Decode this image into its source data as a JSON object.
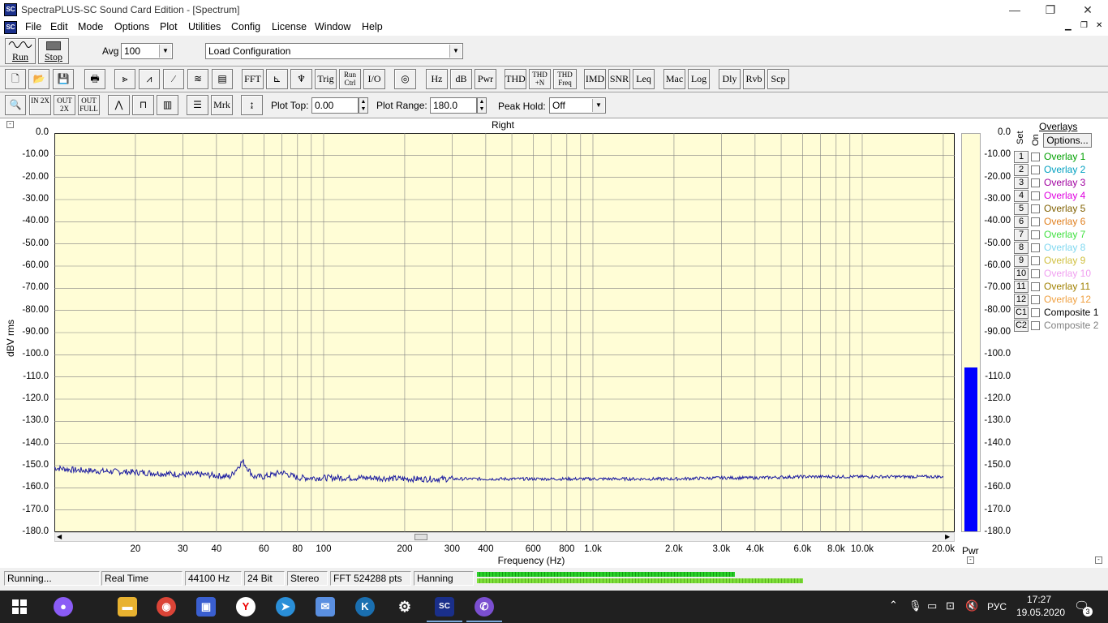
{
  "window": {
    "title": "SpectraPLUS-SC Sound Card Edition - [Spectrum]",
    "minimize": "—",
    "restore": "❐",
    "close": "✕",
    "app_icon": "SC"
  },
  "menu": [
    "File",
    "Edit",
    "Mode",
    "Options",
    "Plot",
    "Utilities",
    "Config",
    "License",
    "Window",
    "Help"
  ],
  "toolbar1": {
    "run_label": "Run",
    "stop_label": "Stop",
    "avg_label": "Avg",
    "avg_value": "100",
    "config_value": "Load Configuration"
  },
  "toolbar2": {
    "buttons": [
      "FFT",
      "Trig",
      "Run Ctrl",
      "I/O",
      "Hz",
      "dB",
      "Pwr",
      "THD",
      "THD +N",
      "THD Freq",
      "IMD",
      "SNR",
      "Leq",
      "Mac",
      "Log",
      "Dly",
      "Rvb",
      "Scp"
    ]
  },
  "toolbar3": {
    "mrk_label": "Mrk",
    "zoom_in_label": "IN 2X",
    "zoom_out_label": "OUT 2X",
    "zoom_full_label": "OUT FULL",
    "plot_top_label": "Plot Top:",
    "plot_top_value": "0.00",
    "plot_range_label": "Plot Range:",
    "plot_range_value": "180.0",
    "peak_hold_label": "Peak Hold:",
    "peak_hold_value": "Off"
  },
  "plot": {
    "channel_title": "Right",
    "y_axis_label": "dBV rms",
    "x_axis_label": "Frequency (Hz)",
    "y_ticks": [
      "0.0",
      "-10.00",
      "-20.00",
      "-30.00",
      "-40.00",
      "-50.00",
      "-60.00",
      "-70.00",
      "-80.00",
      "-90.00",
      "-100.0",
      "-110.0",
      "-120.0",
      "-130.0",
      "-140.0",
      "-150.0",
      "-160.0",
      "-170.0",
      "-180.0"
    ],
    "x_ticks": [
      "20",
      "30",
      "40",
      "60",
      "80",
      "100",
      "200",
      "300",
      "400",
      "600",
      "800",
      "1.0k",
      "2.0k",
      "3.0k",
      "4.0k",
      "6.0k",
      "8.0k",
      "10.0k",
      "20.0k"
    ],
    "pwr_ticks": [
      "0.0",
      "-10.00",
      "-20.00",
      "-30.00",
      "-40.00",
      "-50.00",
      "-60.00",
      "-70.00",
      "-80.00",
      "-90.00",
      "-100.0",
      "-110.0",
      "-120.0",
      "-130.0",
      "-140.0",
      "-150.0",
      "-160.0",
      "-170.0",
      "-180.0"
    ],
    "pwr_label": "Pwr",
    "pwr_level_db": -106,
    "colors": {
      "background": "#fffdd6",
      "trace": "#1a1aa0",
      "pwr_bar": "#0000ff"
    }
  },
  "chart_data": {
    "type": "line",
    "title": "Right",
    "xlabel": "Frequency (Hz)",
    "ylabel": "dBV rms",
    "xscale": "log",
    "xlim": [
      10,
      22050
    ],
    "ylim": [
      -180,
      0
    ],
    "grid": true,
    "series": [
      {
        "values_x": [
          10,
          12,
          15,
          20,
          25,
          30,
          35,
          40,
          45,
          50,
          55,
          60,
          70,
          80,
          100,
          150,
          200,
          300,
          400,
          600,
          800,
          1000,
          2000,
          3000,
          4000,
          6000,
          8000,
          10000,
          15000,
          20000
        ],
        "values_y": [
          -151,
          -152,
          -152.5,
          -153,
          -153.5,
          -154,
          -154,
          -154.5,
          -155,
          -148,
          -155,
          -155,
          -153,
          -155.5,
          -155.5,
          -155.5,
          -156,
          -156,
          -156,
          -156,
          -156,
          -156,
          -156,
          -155.5,
          -155.5,
          -155,
          -155,
          -155,
          -155,
          -155
        ]
      }
    ]
  },
  "overlays": {
    "title": "Overlays",
    "set_label": "Set",
    "on_label": "On",
    "options_label": "Options...",
    "items": [
      {
        "num": "1",
        "name": "Overlay 1",
        "color": "#00a000"
      },
      {
        "num": "2",
        "name": "Overlay 2",
        "color": "#00a0c0"
      },
      {
        "num": "3",
        "name": "Overlay 3",
        "color": "#a000a0"
      },
      {
        "num": "4",
        "name": "Overlay 4",
        "color": "#e000e0"
      },
      {
        "num": "5",
        "name": "Overlay 5",
        "color": "#806000"
      },
      {
        "num": "6",
        "name": "Overlay 6",
        "color": "#e08020"
      },
      {
        "num": "7",
        "name": "Overlay 7",
        "color": "#40e040"
      },
      {
        "num": "8",
        "name": "Overlay 8",
        "color": "#80d8f0"
      },
      {
        "num": "9",
        "name": "Overlay 9",
        "color": "#d0c040"
      },
      {
        "num": "10",
        "name": "Overlay 10",
        "color": "#f0a0f0"
      },
      {
        "num": "11",
        "name": "Overlay 11",
        "color": "#a08000"
      },
      {
        "num": "12",
        "name": "Overlay 12",
        "color": "#f0a040"
      },
      {
        "num": "C1",
        "name": "Composite 1",
        "color": "#000000"
      },
      {
        "num": "C2",
        "name": "Composite 2",
        "color": "#808080"
      }
    ]
  },
  "status": {
    "state": "Running...",
    "mode": "Real Time",
    "rate": "44100 Hz",
    "bits": "24 Bit",
    "channels": "Stereo",
    "fft": "FFT 524288 pts",
    "window": "Hanning",
    "level_left": 0.79,
    "level_right": 1.0
  },
  "taskbar": {
    "lang": "РУС",
    "time": "17:27",
    "date": "19.05.2020",
    "notifications": "3"
  }
}
